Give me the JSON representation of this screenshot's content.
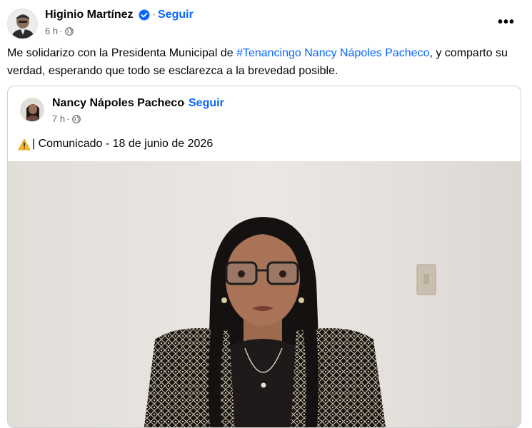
{
  "post": {
    "author": "Higinio Martínez",
    "separator": "·",
    "follow_label": "Seguir",
    "time": "6 h",
    "time_separator": "·",
    "more_label": "•••",
    "text_before": "Me solidarizo con la Presidenta Municipal de ",
    "hashtag": "#Tenancingo Nancy Nápoles Pacheco",
    "text_after": ", y comparto su verdad, esperando que todo se esclarezca a la brevedad posible."
  },
  "shared": {
    "author": "Nancy Nápoles Pacheco",
    "separator": "·",
    "follow_label": "Seguir",
    "time": "7 h",
    "time_separator": "·",
    "text": "| Comunicado - 18 de junio de 2026"
  },
  "colors": {
    "link": "#0866ff",
    "meta": "#65676b",
    "border": "#ced0d4"
  },
  "icons": [
    "verified-badge-icon",
    "globe-icon",
    "more-icon",
    "warning-icon"
  ]
}
